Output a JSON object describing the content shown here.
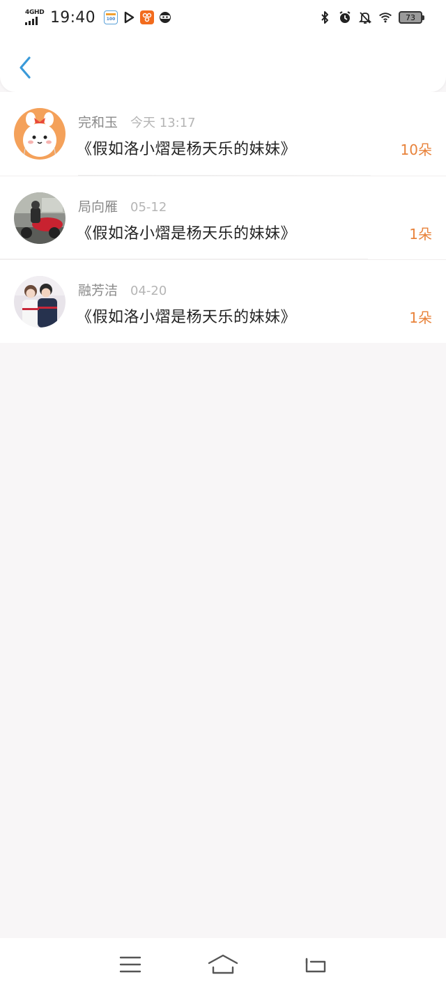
{
  "status_bar": {
    "network": "4GHD",
    "time": "19:40",
    "battery": "73",
    "left_icons": [
      "calendar-app-icon",
      "play-app-icon",
      "orange-app-icon",
      "ninja-app-icon"
    ],
    "right_icons": [
      "bluetooth-icon",
      "alarm-icon",
      "mute-bell-icon",
      "wifi-icon",
      "battery-icon"
    ]
  },
  "header": {
    "back_icon": "chevron-left-icon",
    "accent_color": "#3a9ad9"
  },
  "list": [
    {
      "user": "完和玉",
      "time": "今天 13:17",
      "title": "《假如洛小熠是杨天乐的妹妹》",
      "count": "10朵",
      "avatar": "cartoon-bunny-avatar"
    },
    {
      "user": "局向雁",
      "time": "05-12",
      "title": "《假如洛小熠是杨天乐的妹妹》",
      "count": "1朵",
      "avatar": "motorcycle-photo-avatar"
    },
    {
      "user": "融芳洁",
      "time": "04-20",
      "title": "《假如洛小熠是杨天乐的妹妹》",
      "count": "1朵",
      "avatar": "couple-photo-avatar"
    }
  ],
  "colors": {
    "count": "#e8823a",
    "background": "#f8f6f7"
  },
  "nav": {
    "items": [
      "menu-icon",
      "home-icon",
      "back-icon"
    ]
  }
}
